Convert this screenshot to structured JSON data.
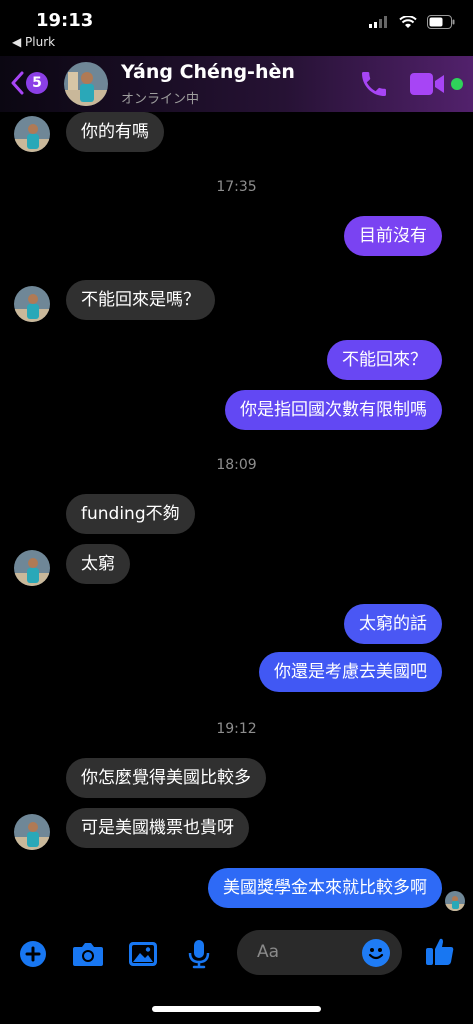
{
  "status_bar": {
    "time": "19:13",
    "back_app": "◀ Plurk",
    "signal_icon": "cellular-signal-icon",
    "wifi_icon": "wifi-icon",
    "battery_icon": "battery-icon"
  },
  "header": {
    "back_icon": "chevron-left-icon",
    "unread_count": "5",
    "contact_name": "Yáng Chéng-hèn",
    "status": "オンライン中",
    "call_icon": "phone-icon",
    "video_icon": "video-camera-icon",
    "accent_color": "#a745f5"
  },
  "messages": [
    {
      "type": "in",
      "text": "你的有嗎"
    },
    {
      "type": "timestamp",
      "text": "17:35"
    },
    {
      "type": "out",
      "text": "目前沒有"
    },
    {
      "type": "in",
      "text": "不能回來是嗎？"
    },
    {
      "type": "out",
      "text": "不能回來？"
    },
    {
      "type": "out",
      "text": "你是指回國次數有限制嗎"
    },
    {
      "type": "timestamp",
      "text": "18:09"
    },
    {
      "type": "in",
      "text": "funding不夠"
    },
    {
      "type": "in",
      "text": "太窮"
    },
    {
      "type": "out",
      "text": "太窮的話"
    },
    {
      "type": "out",
      "text": "你還是考慮去美國吧"
    },
    {
      "type": "timestamp",
      "text": "19:12"
    },
    {
      "type": "in",
      "text": "你怎麼覺得美國比較多"
    },
    {
      "type": "in",
      "text": "可是美國機票也貴呀"
    },
    {
      "type": "out",
      "text": "美國獎學金本來就比較多啊"
    }
  ],
  "composer": {
    "placeholder": "Aa",
    "icons": [
      "plus-icon",
      "camera-icon",
      "image-icon",
      "microphone-icon",
      "emoji-icon",
      "thumbs-up-icon"
    ],
    "icon_color": "#1877f2"
  },
  "colors": {
    "incoming_bubble": "#303030",
    "outgoing_gradient": [
      "#8a3ff0",
      "#2f6ef7"
    ]
  }
}
